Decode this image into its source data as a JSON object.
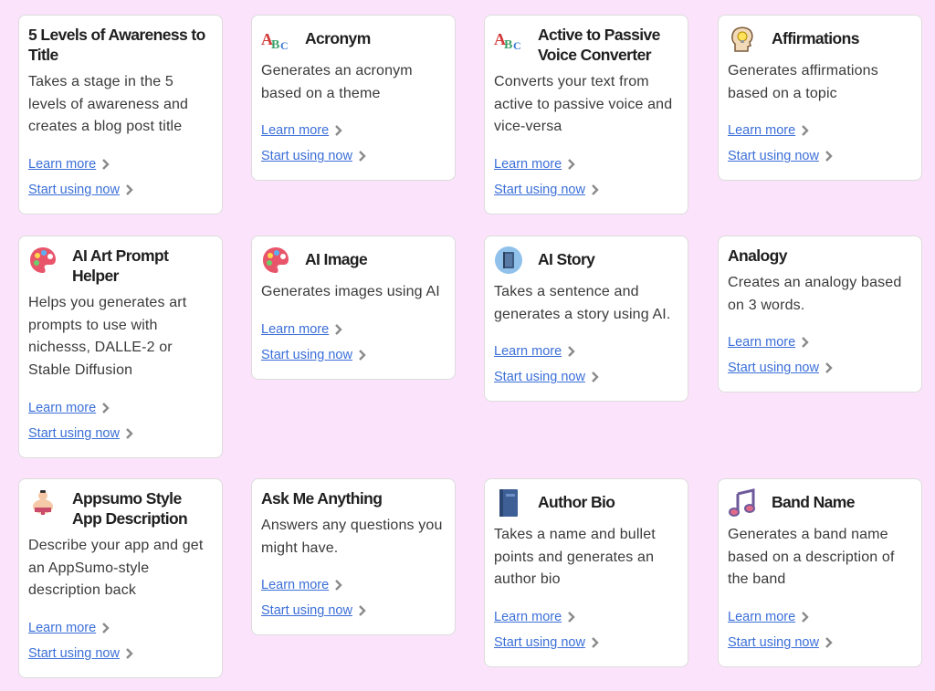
{
  "cards": [
    {
      "id": "five-levels",
      "title": "5 Levels of Awareness to Title",
      "description": "Takes a stage in the 5 levels of awareness and creates a blog post title",
      "icon": "none",
      "learn_more": "Learn more",
      "start_using": "Start using now"
    },
    {
      "id": "acronym",
      "title": "Acronym",
      "description": "Generates an acronym based on a theme",
      "icon": "abc-letters-icon",
      "learn_more": "Learn more",
      "start_using": "Start using now"
    },
    {
      "id": "active-passive",
      "title": "Active to Passive Voice Converter",
      "description": "Converts your text from active to passive voice and vice-versa",
      "icon": "abc-letters-icon",
      "learn_more": "Learn more",
      "start_using": "Start using now"
    },
    {
      "id": "affirmations",
      "title": "Affirmations",
      "description": "Generates affirmations based on a topic",
      "icon": "head-lightbulb-icon",
      "learn_more": "Learn more",
      "start_using": "Start using now"
    },
    {
      "id": "ai-art",
      "title": "AI Art Prompt Helper",
      "description": "Helps you generates art prompts to use with nichesss, DALLE-2 or Stable Diffusion",
      "icon": "paint-palette-icon",
      "learn_more": "Learn more",
      "start_using": "Start using now"
    },
    {
      "id": "ai-image",
      "title": "AI Image",
      "description": "Generates images using AI",
      "icon": "paint-palette-icon",
      "learn_more": "Learn more",
      "start_using": "Start using now"
    },
    {
      "id": "ai-story",
      "title": "AI Story",
      "description": "Takes a sentence and generates a story using AI.",
      "icon": "book-icon",
      "learn_more": "Learn more",
      "start_using": "Start using now"
    },
    {
      "id": "analogy",
      "title": "Analogy",
      "description": "Creates an analogy based on 3 words.",
      "icon": "none",
      "learn_more": "Learn more",
      "start_using": "Start using now"
    },
    {
      "id": "appsumo",
      "title": "Appsumo Style App Description",
      "description": "Describe your app and get an AppSumo-style description back",
      "icon": "sumo-wrestler-icon",
      "learn_more": "Learn more",
      "start_using": "Start using now"
    },
    {
      "id": "ask-me",
      "title": "Ask Me Anything",
      "description": "Answers any questions you might have.",
      "icon": "none",
      "learn_more": "Learn more",
      "start_using": "Start using now"
    },
    {
      "id": "author-bio",
      "title": "Author Bio",
      "description": "Takes a name and bullet points and generates an author bio",
      "icon": "notebook-icon",
      "learn_more": "Learn more",
      "start_using": "Start using now"
    },
    {
      "id": "band-name",
      "title": "Band Name",
      "description": "Generates a band name based on a description of the band",
      "icon": "music-notes-icon",
      "learn_more": "Learn more",
      "start_using": "Start using now"
    }
  ]
}
